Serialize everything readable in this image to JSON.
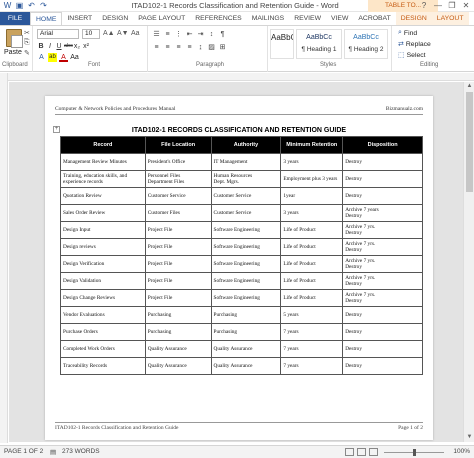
{
  "window": {
    "title": "ITAD102-1 Records Classification and Retention Guide - Word",
    "context_group": "TABLE TO...",
    "controls": [
      "?",
      "—",
      "❐",
      "✕"
    ]
  },
  "tabs": [
    {
      "label": "FILE",
      "kind": "file"
    },
    {
      "label": "HOME",
      "kind": "active"
    },
    {
      "label": "INSERT",
      "kind": "normal"
    },
    {
      "label": "DESIGN",
      "kind": "normal"
    },
    {
      "label": "PAGE LAYOUT",
      "kind": "normal"
    },
    {
      "label": "REFERENCES",
      "kind": "normal"
    },
    {
      "label": "MAILINGS",
      "kind": "normal"
    },
    {
      "label": "REVIEW",
      "kind": "normal"
    },
    {
      "label": "VIEW",
      "kind": "normal"
    },
    {
      "label": "ACROBAT",
      "kind": "normal"
    },
    {
      "label": "DESIGN",
      "kind": "ctx"
    },
    {
      "label": "LAYOUT",
      "kind": "ctx"
    }
  ],
  "ribbon": {
    "paste_label": "Paste",
    "font_name": "Arial",
    "font_size": "10",
    "format_buttons": [
      "B",
      "I",
      "U",
      "abc",
      "x₂",
      "x²"
    ],
    "color_buttons": [
      "A",
      "ab",
      "A",
      "Aa"
    ],
    "styles": [
      {
        "sample": "AaBbCc",
        "name": "¶ Normal",
        "kind": "normal"
      },
      {
        "sample": "AaBbCc",
        "name": "¶ No Spac...",
        "kind": "normal"
      },
      {
        "sample": "AaBbCc",
        "name": "¶ Heading 1",
        "kind": "heading"
      },
      {
        "sample": "AaBbCc",
        "name": "¶ Heading 2",
        "kind": "heading2"
      }
    ],
    "editing": {
      "find": "Find",
      "replace": "Replace",
      "select": "Select"
    },
    "group_labels": {
      "clipboard": "Clipboard",
      "font": "Font",
      "paragraph": "Paragraph",
      "styles": "Styles",
      "editing": "Editing"
    }
  },
  "document": {
    "header_left": "Computer & Network Policies and Procedures Manual",
    "header_right": "Bizmanualz.com",
    "title": "ITAD102-1   RECORDS CLASSIFICATION AND RETENTION GUIDE",
    "columns": [
      "Record",
      "File Location",
      "Authority",
      "Minimum Retention",
      "Disposition"
    ],
    "rows": [
      [
        "Management Review Minutes",
        "President's Office",
        "IT Management",
        "3 years",
        "Destroy"
      ],
      [
        "Training, education skills, and experience records",
        "Personnel Files\nDepartment Files",
        "Human Resources\nDept. Mgrs.",
        "Employment plus 3 years",
        "Destroy"
      ],
      [
        "Quotation Review",
        "Customer Service",
        "Customer Service",
        "1year",
        "Destroy"
      ],
      [
        "Sales Order Review",
        "Customer Files",
        "Customer Service",
        "3 years",
        "Archive 7 years\nDestroy"
      ],
      [
        "Design Input",
        "Project File",
        "Software Engineering",
        "Life of Product",
        "Archive 7 yrs.\nDestroy"
      ],
      [
        "Design reviews",
        "Project File",
        "Software Engineering",
        "Life of Product",
        "Archive 7 yrs.\nDestroy"
      ],
      [
        "Design Verification",
        "Project File",
        "Software Engineering",
        "Life of Product",
        "Archive 7 yrs.\nDestroy"
      ],
      [
        "Design Validation",
        "Project File",
        "Software Engineering",
        "Life of Product",
        "Archive 7 yrs.\nDestroy"
      ],
      [
        "Design Change Reviews",
        "Project File",
        "Software Engineering",
        "Life of Product",
        "Archive 7 yrs.\nDestroy"
      ],
      [
        "Vendor Evaluations",
        "Purchasing",
        "Purchasing",
        "5 years",
        "Destroy"
      ],
      [
        "Purchase Orders",
        "Purchasing",
        "Purchasing",
        "7 years",
        "Destroy"
      ],
      [
        "Completed Work Orders",
        "Quality Assurance",
        "Quality Assurance",
        "7 years",
        "Destroy"
      ],
      [
        "Traceability Records",
        "Quality Assurance",
        "Quality Assurance",
        "7 years",
        "Destroy"
      ]
    ],
    "footer_left": "ITAD102-1 Records Classification and Retention Guide",
    "footer_right": "Page 1 of 2"
  },
  "status": {
    "page": "PAGE 1 OF 2",
    "words": "273 WORDS",
    "zoom": "100%"
  }
}
